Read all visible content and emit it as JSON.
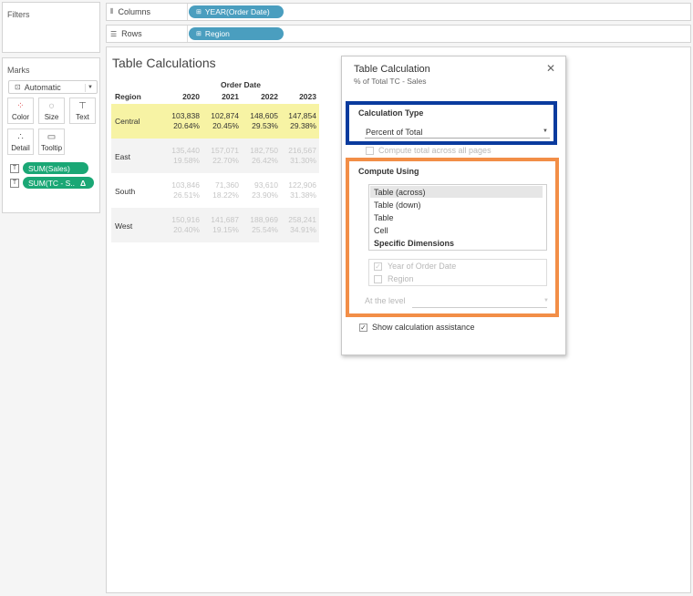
{
  "panels": {
    "filters_title": "Filters",
    "marks_title": "Marks"
  },
  "marks": {
    "mark_type": "Automatic",
    "buttons": {
      "color": "Color",
      "size": "Size",
      "text": "Text",
      "detail": "Detail",
      "tooltip": "Tooltip"
    },
    "pills": [
      {
        "label": "SUM(Sales)"
      },
      {
        "label": "SUM(TC - S..",
        "delta": "Δ"
      }
    ]
  },
  "shelves": {
    "columns_label": "Columns",
    "columns_pill": "YEAR(Order Date)",
    "rows_label": "Rows",
    "rows_pill": "Region"
  },
  "sheet": {
    "title": "Table Calculations",
    "header_group": "Order Date",
    "region_header": "Region",
    "years": [
      "2020",
      "2021",
      "2022",
      "2023"
    ],
    "rows": [
      {
        "region": "Central",
        "values": [
          "103,838",
          "102,874",
          "148,605",
          "147,854"
        ],
        "pcts": [
          "20.64%",
          "20.45%",
          "29.53%",
          "29.38%"
        ],
        "highlight": true
      },
      {
        "region": "East",
        "values": [
          "135,440",
          "157,071",
          "182,750",
          "216,567"
        ],
        "pcts": [
          "19.58%",
          "22.70%",
          "26.42%",
          "31.30%"
        ],
        "highlight": false
      },
      {
        "region": "South",
        "values": [
          "103,846",
          "71,360",
          "93,610",
          "122,906"
        ],
        "pcts": [
          "26.51%",
          "18.22%",
          "23.90%",
          "31.38%"
        ],
        "highlight": false
      },
      {
        "region": "West",
        "values": [
          "150,916",
          "141,687",
          "188,969",
          "258,241"
        ],
        "pcts": [
          "20.40%",
          "19.15%",
          "25.54%",
          "34.91%"
        ],
        "highlight": false
      }
    ],
    "highlight_color": "#f7f3a4",
    "alt_row_color": "#f3f3f3"
  },
  "dialog": {
    "title": "Table Calculation",
    "subtitle": "% of Total TC - Sales",
    "close_glyph": "✕",
    "calc_type_title": "Calculation Type",
    "calc_type_value": "Percent of Total",
    "compute_total_label": "Compute total across all pages",
    "compute_using_title": "Compute Using",
    "compute_using_options": [
      "Table (across)",
      "Table (down)",
      "Table",
      "Cell",
      "Specific Dimensions"
    ],
    "selected_option": "Table (across)",
    "dimensions": [
      {
        "label": "Year of Order Date",
        "checked": true
      },
      {
        "label": "Region",
        "checked": false
      }
    ],
    "at_level_label": "At the level",
    "show_assistance_label": "Show calculation assistance",
    "show_assistance_checked": true
  },
  "colors": {
    "pill_blue": "#4a9ebf",
    "pill_green": "#1aa775",
    "frame_blue": "#0a3b9e",
    "frame_orange": "#f28e47"
  }
}
